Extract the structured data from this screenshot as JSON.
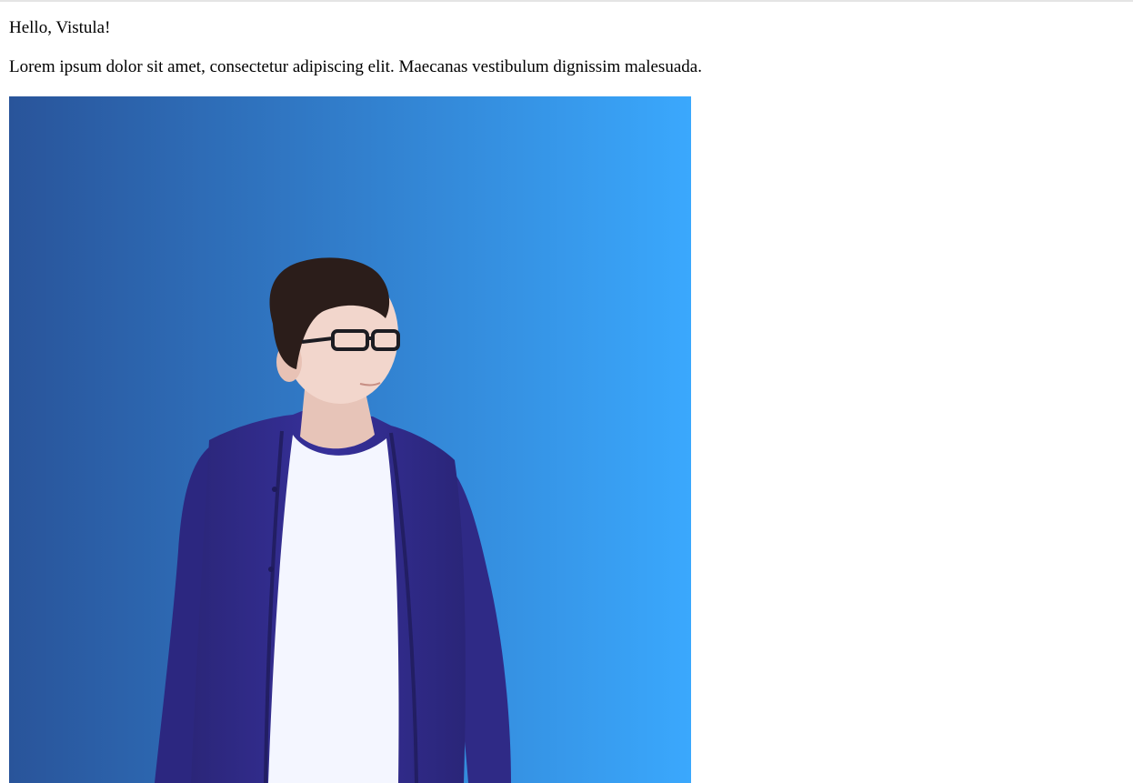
{
  "page": {
    "greeting": "Hello, Vistula!",
    "paragraph": "Lorem ipsum dolor sit amet, consectetur adipiscing elit. Maecanas vestibulum dignissim malesuada."
  },
  "photo": {
    "subject": "person-portrait",
    "colors": {
      "gradient_start": "#29549a",
      "gradient_end": "#3aa8fd",
      "shirt": "#302b86",
      "tshirt": "#f6f8ff",
      "hair": "#2b1d1a",
      "skin": "#f2d6cc"
    }
  }
}
